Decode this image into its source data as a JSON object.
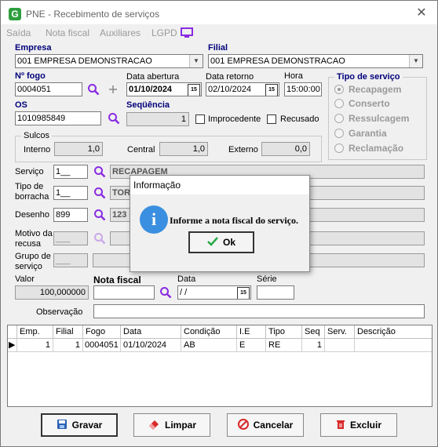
{
  "window": {
    "title": "PNE - Recebimento de serviços",
    "close_glyph": "✕"
  },
  "menu": [
    "Saída",
    "Nota fiscal",
    "Auxiliares",
    "LGPD"
  ],
  "empresa": {
    "label": "Empresa",
    "value": "001 EMPRESA DEMONSTRACAO"
  },
  "filial": {
    "label": "Filial",
    "value": "001 EMPRESA DEMONSTRACAO"
  },
  "fogo": {
    "label": "Nº fogo",
    "value": "0004051"
  },
  "data_abertura": {
    "label": "Data abertura",
    "value": "01/10/2024"
  },
  "data_retorno": {
    "label": "Data retorno",
    "value": "02/10/2024"
  },
  "hora": {
    "label": "Hora",
    "value": "15:00:00"
  },
  "tipo_servico": {
    "title": "Tipo de serviço",
    "options": [
      "Recapagem",
      "Conserto",
      "Ressulcagem",
      "Garantia",
      "Reclamação"
    ],
    "selected": "Recapagem"
  },
  "os": {
    "label": "OS",
    "value": "1010985849"
  },
  "sequencia": {
    "label": "Seqüência",
    "value": "1"
  },
  "improcedente": {
    "label": "Improcedente",
    "checked": false
  },
  "recusado": {
    "label": "Recusado",
    "checked": false
  },
  "sulcos": {
    "title": "Sulcos",
    "interno_label": "Interno",
    "interno": "1,0",
    "central_label": "Central",
    "central": "1,0",
    "externo_label": "Externo",
    "externo": "0,0"
  },
  "servico": {
    "label": "Serviço",
    "code": "1__",
    "desc": "RECAPAGEM"
  },
  "tipo_borracha": {
    "label1": "Tipo de",
    "label2": "borracha",
    "code": "1__",
    "desc": "TOR"
  },
  "desenho": {
    "label": "Desenho",
    "code": "899",
    "desc": "123"
  },
  "motivo_recusa": {
    "label1": "Motivo da",
    "label2": "recusa",
    "code": "___"
  },
  "grupo_servico": {
    "label1": "Grupo de",
    "label2": "serviço",
    "code": "___"
  },
  "valor": {
    "label": "Valor",
    "value": "100,000000"
  },
  "nota_fiscal": {
    "label": "Nota fiscal",
    "value": ""
  },
  "data_nf": {
    "label": "Data",
    "value": " / /"
  },
  "serie": {
    "label": "Série",
    "value": ""
  },
  "observacao": {
    "label": "Observação",
    "value": ""
  },
  "grid": {
    "columns": [
      "Emp.",
      "Filial",
      "Fogo",
      "Data",
      "Condição",
      "I.E",
      "Tipo",
      "Seq",
      "Serv.",
      "Descrição"
    ],
    "rows": [
      [
        "1",
        "1",
        "0004051",
        "01/10/2024",
        "AB",
        "E",
        "RE",
        "1",
        "",
        ""
      ]
    ]
  },
  "buttons": {
    "gravar": "Gravar",
    "limpar": "Limpar",
    "cancelar": "Cancelar",
    "excluir": "Excluir"
  },
  "dialog": {
    "title": "Informação",
    "message": "Informe a nota fiscal do serviço.",
    "ok": "Ok",
    "icon": "i"
  }
}
